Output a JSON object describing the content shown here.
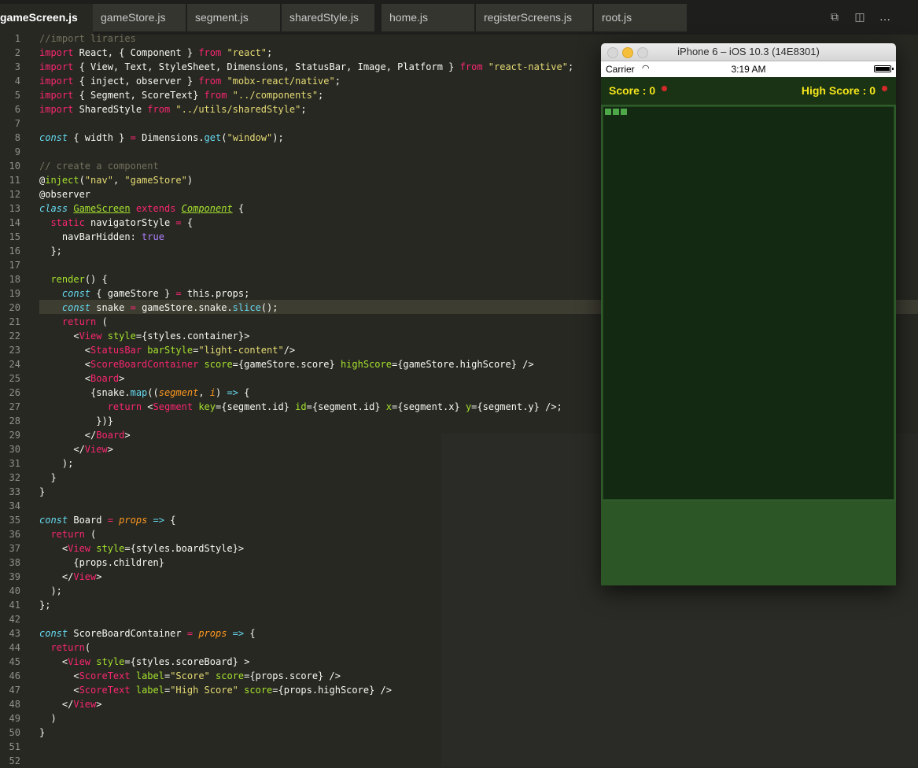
{
  "tabs": [
    {
      "label": "gameScreen.js",
      "active": true
    },
    {
      "label": "gameStore.js"
    },
    {
      "label": "segment.js"
    },
    {
      "label": "sharedStyle.js"
    },
    {
      "label": "home.js"
    },
    {
      "label": "registerScreens.js"
    },
    {
      "label": "root.js"
    }
  ],
  "icons": {
    "split": "split-editor-icon",
    "layout": "layout-icon",
    "more": "more-icon"
  },
  "code_lines": [
    "1",
    "2",
    "3",
    "4",
    "5",
    "6",
    "7",
    "8",
    "9",
    "10",
    "11",
    "12",
    "13",
    "14",
    "15",
    "16",
    "17",
    "18",
    "19",
    "20",
    "21",
    "22",
    "23",
    "24",
    "25",
    "26",
    "27",
    "28",
    "29",
    "30",
    "31",
    "32",
    "33",
    "34",
    "35",
    "36",
    "37",
    "38",
    "39",
    "40",
    "41",
    "42",
    "43",
    "44",
    "45",
    "46",
    "47",
    "48",
    "49",
    "50",
    "51",
    "52"
  ],
  "simulator": {
    "title": "iPhone 6 – iOS 10.3 (14E8301)",
    "carrier": "Carrier",
    "time": "3:19 AM",
    "score_label": "Score : 0",
    "high_score_label": "High Score : 0",
    "snake_segments": 3
  },
  "colors": {
    "editor_bg": "#272822",
    "board_bg": "#132911",
    "score_text": "#f5e61b",
    "snake": "#4ea84a"
  }
}
